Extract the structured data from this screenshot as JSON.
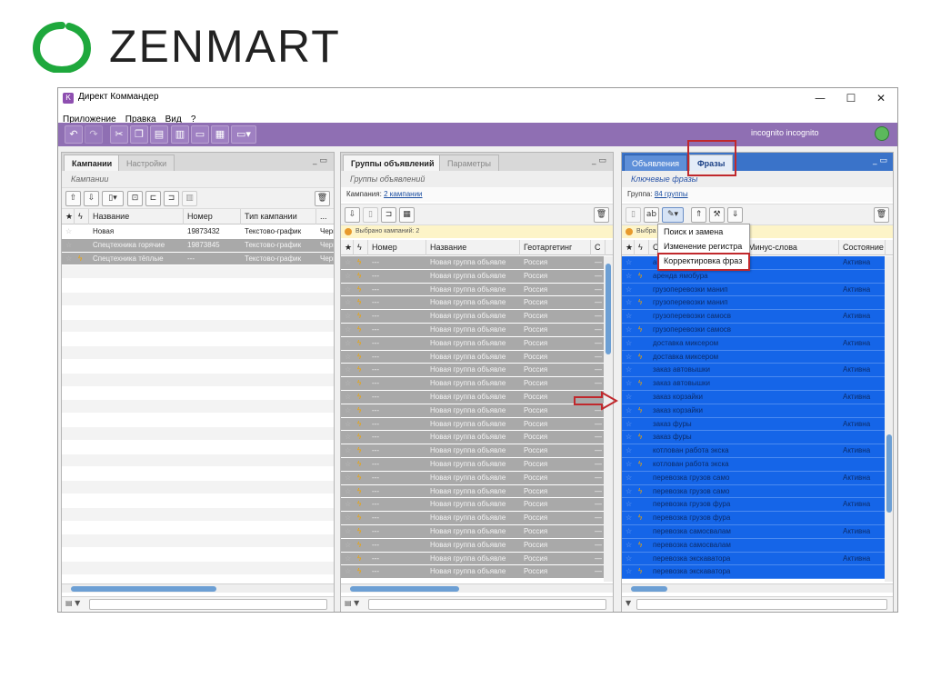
{
  "logo": {
    "text": "ZENMART"
  },
  "window": {
    "title": "Директ Коммандер",
    "app_icon": "К",
    "minimize": "—",
    "maximize": "☐",
    "close": "✕"
  },
  "menu": [
    "Приложение",
    "Правка",
    "Вид",
    "?"
  ],
  "toolbar": {
    "user": "incognito incognito",
    "buttons": [
      "undo-icon",
      "redo-icon",
      "cut-icon",
      "copy-icon",
      "paste-icon",
      "chart-icon",
      "window-icon",
      "table-icon",
      "dropdown-icon"
    ]
  },
  "left_panel": {
    "tab_active": "Кампании",
    "tab_inactive": "Настройки",
    "subtitle": "Кампании",
    "columns": [
      "Название",
      "Номер",
      "Тип кампании",
      "..."
    ],
    "rows": [
      {
        "name": "Новая",
        "number": "19873432",
        "type": "Текстово-график",
        "extra": "Черн"
      },
      {
        "name": "Спецтехника горячие",
        "number": "19873845",
        "type": "Текстово-график",
        "extra": "Черн"
      },
      {
        "name": "Спецтехника тёплые",
        "number": "---",
        "type": "Текстово-график",
        "extra": "Черн"
      }
    ]
  },
  "middle_panel": {
    "tab_active": "Группы объявлений",
    "tab_inactive": "Параметры",
    "subtitle": "Группы объявлений",
    "campaign_label": "Кампания:",
    "campaign_link": "2 кампании",
    "notice": "Выбрано кампаний: 2",
    "columns": [
      "Номер",
      "Название",
      "Геотаргетинг",
      "С"
    ],
    "row": {
      "number": "---",
      "name": "Новая группа объявле",
      "geo": "Россия",
      "extra": "—"
    },
    "row_count": 24
  },
  "right_panel": {
    "tab_inactive": "Объявления",
    "tab_active": "Фразы",
    "subtitle": "Ключевые фразы",
    "group_label": "Группа:",
    "group_link": "84 группы",
    "notice": "Выбра",
    "columns": [
      "С",
      "Минус-слова",
      "Состояние"
    ],
    "rows": [
      {
        "phrase": "аренда ямобура",
        "state": "Активна",
        "bolt": false
      },
      {
        "phrase": "аренда ямобура",
        "state": "",
        "bolt": true
      },
      {
        "phrase": "грузоперевозки манип",
        "state": "Активна",
        "bolt": false
      },
      {
        "phrase": "грузоперевозки манип",
        "state": "",
        "bolt": true
      },
      {
        "phrase": "грузоперевозки самосв",
        "state": "Активна",
        "bolt": false
      },
      {
        "phrase": "грузоперевозки самосв",
        "state": "",
        "bolt": true
      },
      {
        "phrase": "доставка миксером",
        "state": "Активна",
        "bolt": false
      },
      {
        "phrase": "доставка миксером",
        "state": "",
        "bolt": true
      },
      {
        "phrase": "заказ автовышки",
        "state": "Активна",
        "bolt": false
      },
      {
        "phrase": "заказ автовышки",
        "state": "",
        "bolt": true
      },
      {
        "phrase": "заказ корзайки",
        "state": "Активна",
        "bolt": false
      },
      {
        "phrase": "заказ корзайки",
        "state": "",
        "bolt": true
      },
      {
        "phrase": "заказ фуры",
        "state": "Активна",
        "bolt": false
      },
      {
        "phrase": "заказ фуры",
        "state": "",
        "bolt": true
      },
      {
        "phrase": "котлован работа экска",
        "state": "Активна",
        "bolt": false
      },
      {
        "phrase": "котлован работа экска",
        "state": "",
        "bolt": true
      },
      {
        "phrase": "перевозка грузов само",
        "state": "Активна",
        "bolt": false
      },
      {
        "phrase": "перевозка грузов само",
        "state": "",
        "bolt": true
      },
      {
        "phrase": "перевозка грузов фура",
        "state": "Активна",
        "bolt": false
      },
      {
        "phrase": "перевозка грузов фура",
        "state": "",
        "bolt": true
      },
      {
        "phrase": "перевозка самосвалам",
        "state": "Активна",
        "bolt": false
      },
      {
        "phrase": "перевозка самосвалам",
        "state": "",
        "bolt": true
      },
      {
        "phrase": "перевозка экскаватора",
        "state": "Активна",
        "bolt": false
      },
      {
        "phrase": "перевозка экскаватора",
        "state": "",
        "bolt": true
      }
    ]
  },
  "context_menu": {
    "items": [
      "Поиск и замена",
      "Изменение регистра",
      "Корректировка фраз"
    ]
  },
  "colors": {
    "toolbar": "#8f6fb3",
    "selection": "#1565e8",
    "gray_selection": "#a9a9a9",
    "annotation": "#c0282c"
  }
}
